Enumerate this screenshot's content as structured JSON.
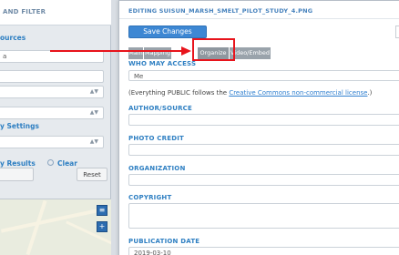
{
  "sidebar": {
    "title": "AND FILTER",
    "labels": [
      "ources",
      "y Settings"
    ],
    "fields": [
      "a",
      "",
      "",
      ""
    ],
    "results_label": "y Results",
    "clear_label": "Clear",
    "reset_label": "Reset"
  },
  "editor": {
    "title": "EDITING SUISUN_MARSH_SMELT_PILOT_STUDY_4.PNG",
    "save_label": "Save Changes",
    "tabs": [
      "Main",
      "Mapping",
      "Organize",
      "Video/Embed"
    ],
    "fields": {
      "who_may_access": {
        "label": "WHO MAY ACCESS",
        "value": "Me"
      },
      "license_note_prefix": "(Everything PUBLIC follows the ",
      "license_link": "Creative Commons non-commercial license",
      "license_note_suffix": ".)",
      "author_source": {
        "label": "AUTHOR/SOURCE",
        "value": ""
      },
      "photo_credit": {
        "label": "PHOTO CREDIT",
        "value": ""
      },
      "organization": {
        "label": "ORGANIZATION",
        "value": ""
      },
      "copyright": {
        "label": "COPYRIGHT",
        "value": ""
      },
      "publication_date": {
        "label": "PUBLICATION DATE",
        "value": "2019-03-10"
      }
    }
  },
  "annotation": {
    "highlight_color": "#e8141c",
    "target": "Organize"
  },
  "colors": {
    "accent": "#3d87d3",
    "label_blue": "#2e7fc2",
    "tab_gray": "#9aa3ab"
  }
}
